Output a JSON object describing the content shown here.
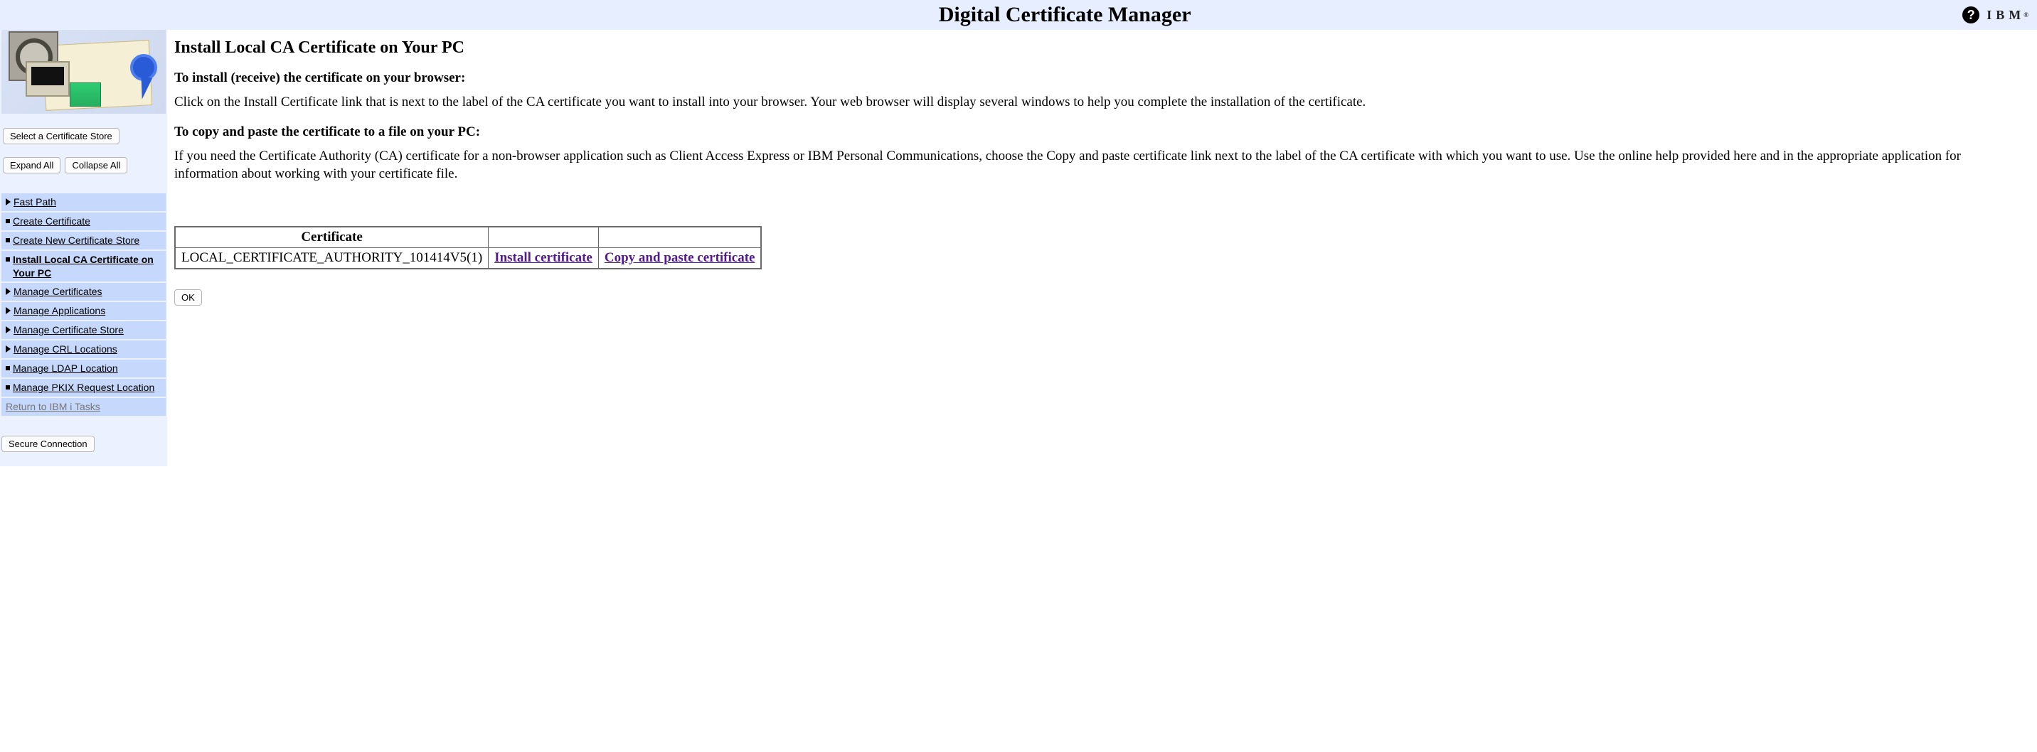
{
  "header": {
    "title": "Digital Certificate Manager",
    "help_icon": "help-icon",
    "brand": "IBM",
    "brand_reg": "®"
  },
  "sidebar": {
    "select_store_label": "Select a Certificate Store",
    "expand_all_label": "Expand All",
    "collapse_all_label": "Collapse All",
    "items": [
      {
        "label": "Fast Path",
        "marker": "tri"
      },
      {
        "label": "Create Certificate",
        "marker": "sq"
      },
      {
        "label": "Create New Certificate Store",
        "marker": "sq"
      },
      {
        "label": "Install Local CA Certificate on Your PC",
        "marker": "sq",
        "active": true
      },
      {
        "label": "Manage Certificates",
        "marker": "tri"
      },
      {
        "label": "Manage Applications",
        "marker": "tri"
      },
      {
        "label": "Manage Certificate Store",
        "marker": "tri"
      },
      {
        "label": "Manage CRL Locations",
        "marker": "tri"
      },
      {
        "label": "Manage LDAP Location",
        "marker": "sq"
      },
      {
        "label": "Manage PKIX Request Location",
        "marker": "sq"
      },
      {
        "label": "Return to IBM i Tasks",
        "marker": "none",
        "return": true
      }
    ],
    "secure_connection_label": "Secure Connection"
  },
  "main": {
    "heading": "Install Local CA Certificate on Your PC",
    "section1_title": "To install (receive) the certificate on your browser:",
    "section1_body": "Click on the Install Certificate link that is next to the label of the CA certificate you want to install into your browser. Your web browser will display several windows to help you complete the installation of the certificate.",
    "section2_title": "To copy and paste the certificate to a file on your PC:",
    "section2_body": "If you need the Certificate Authority (CA) certificate for a non-browser application such as Client Access Express or IBM Personal Communications, choose the Copy and paste certificate link next to the label of the CA certificate with which you want to use. Use the online help provided here and in the appropriate application for information about working with your certificate file.",
    "table": {
      "head_certificate": "Certificate",
      "rows": [
        {
          "certificate": "LOCAL_CERTIFICATE_AUTHORITY_101414V5(1)",
          "install_label": "Install certificate",
          "copy_label": "Copy and paste certificate"
        }
      ]
    },
    "ok_label": "OK"
  }
}
